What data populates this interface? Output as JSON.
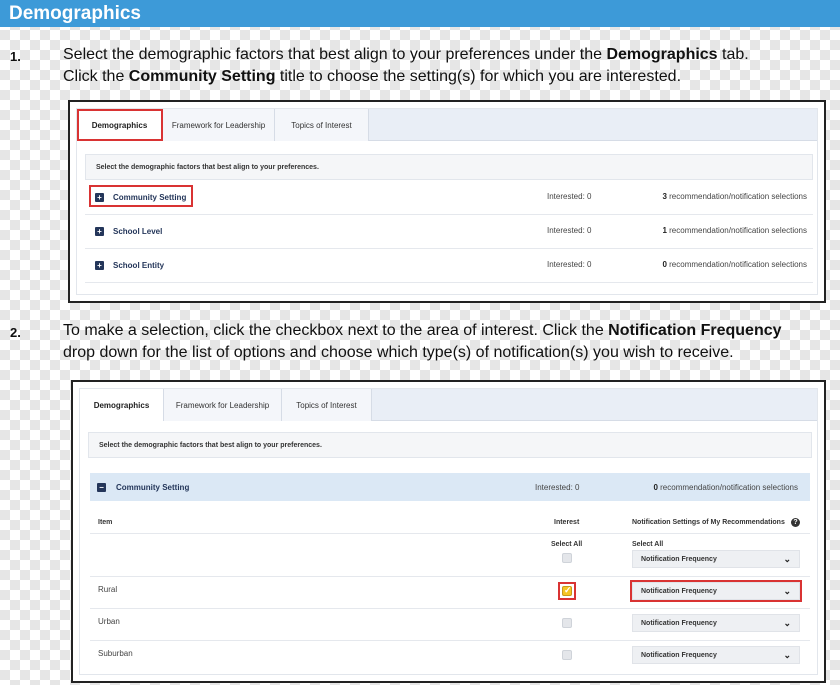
{
  "header": {
    "title": "Demographics"
  },
  "steps": [
    {
      "num": "1.",
      "line1_pre": "Select the demographic factors that best align to your preferences under the ",
      "line1_bold": "Demographics",
      "line1_post": " tab.",
      "line2_pre": "Click the ",
      "line2_bold": "Community Setting",
      "line2_post": " title to choose the setting(s) for which you are interested."
    },
    {
      "num": "2.",
      "line1_pre": "To make a selection, click the checkbox next to the area of interest. Click the ",
      "line1_bold": "Notification Frequency",
      "line2": "drop down for the list of options and choose which type(s) of notification(s) you wish to receive."
    }
  ],
  "tabs": [
    "Demographics",
    "Framework for Leadership",
    "Topics of Interest"
  ],
  "instruction": "Select the demographic factors that best align to your preferences.",
  "panel1": {
    "rows": [
      {
        "label": "Community Setting",
        "interested": "Interested: 0",
        "count": "3",
        "recs": " recommendation/notification selections"
      },
      {
        "label": "School Level",
        "interested": "Interested: 0",
        "count": "1",
        "recs": " recommendation/notification selections"
      },
      {
        "label": "School Entity",
        "interested": "Interested: 0",
        "count": "0",
        "recs": " recommendation/notification selections"
      }
    ]
  },
  "panel2": {
    "section": {
      "label": "Community Setting",
      "interested": "Interested: 0",
      "count": "0",
      "recs": " recommendation/notification selections"
    },
    "columns": {
      "item": "Item",
      "interest": "Interest",
      "notif": "Notification Settings of My Recommendations"
    },
    "select_all_interest": "Select All",
    "select_all_notif": "Select All",
    "dropdown_value": "Notification Frequency",
    "items": [
      "Rural",
      "Urban",
      "Suburban"
    ],
    "rural_checked": true
  },
  "icons": {
    "expand": "plus-square-icon",
    "collapse": "minus-square-icon",
    "chevron": "chevron-down-icon",
    "help": "help-icon"
  },
  "colors": {
    "title_bar": "#3d9ad8",
    "highlight": "#d93333",
    "checked": "#f5c424"
  }
}
